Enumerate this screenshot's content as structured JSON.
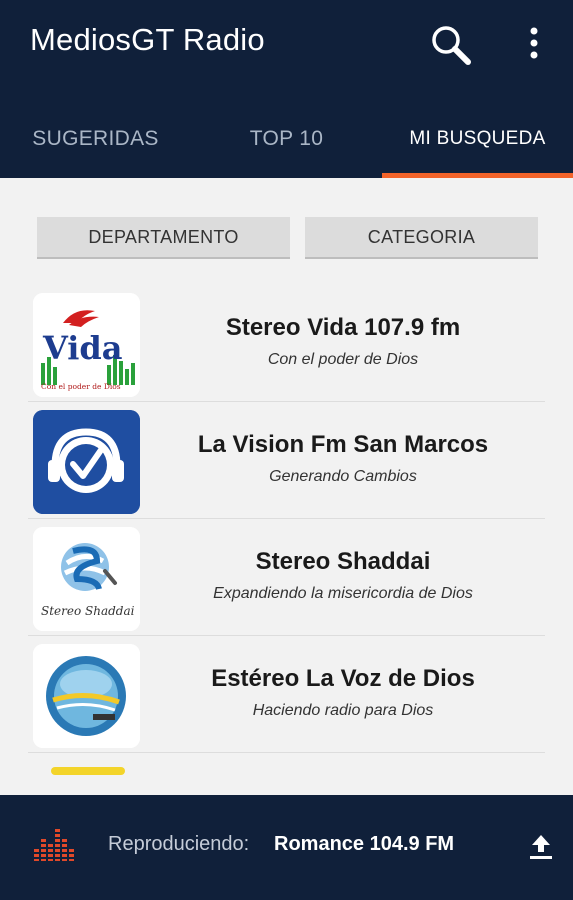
{
  "app": {
    "title": "MediosGT Radio"
  },
  "toolbar": {
    "search_icon": "search-icon",
    "more_icon": "more-vert-icon"
  },
  "tabs": [
    {
      "label": "SUGERIDAS",
      "active": false
    },
    {
      "label": "TOP 10",
      "active": false
    },
    {
      "label": "MI BUSQUEDA",
      "active": true
    }
  ],
  "colors": {
    "appbar": "#10203a",
    "accent": "#f2632a",
    "background": "#f2f2f2"
  },
  "filters": {
    "department_label": "DEPARTAMENTO",
    "category_label": "CATEGORIA"
  },
  "stations": [
    {
      "name": "Stereo Vida 107.9 fm",
      "slogan": "Con el poder de Dios",
      "logo_text": "Vida",
      "logo_caption": "Con el poder de Dios"
    },
    {
      "name": "La Vision Fm San Marcos",
      "slogan": "Generando Cambios"
    },
    {
      "name": "Stereo Shaddai",
      "slogan": "Expandiendo la misericordia de Dios",
      "logo_text": "Stereo Shaddai"
    },
    {
      "name": "Estéreo La Voz de Dios",
      "slogan": "Haciendo radio para Dios"
    }
  ],
  "player": {
    "label": "Reproduciendo:",
    "station": "Romance 104.9 FM",
    "eq_icon": "equalizer-icon",
    "expand_icon": "upload-icon"
  }
}
